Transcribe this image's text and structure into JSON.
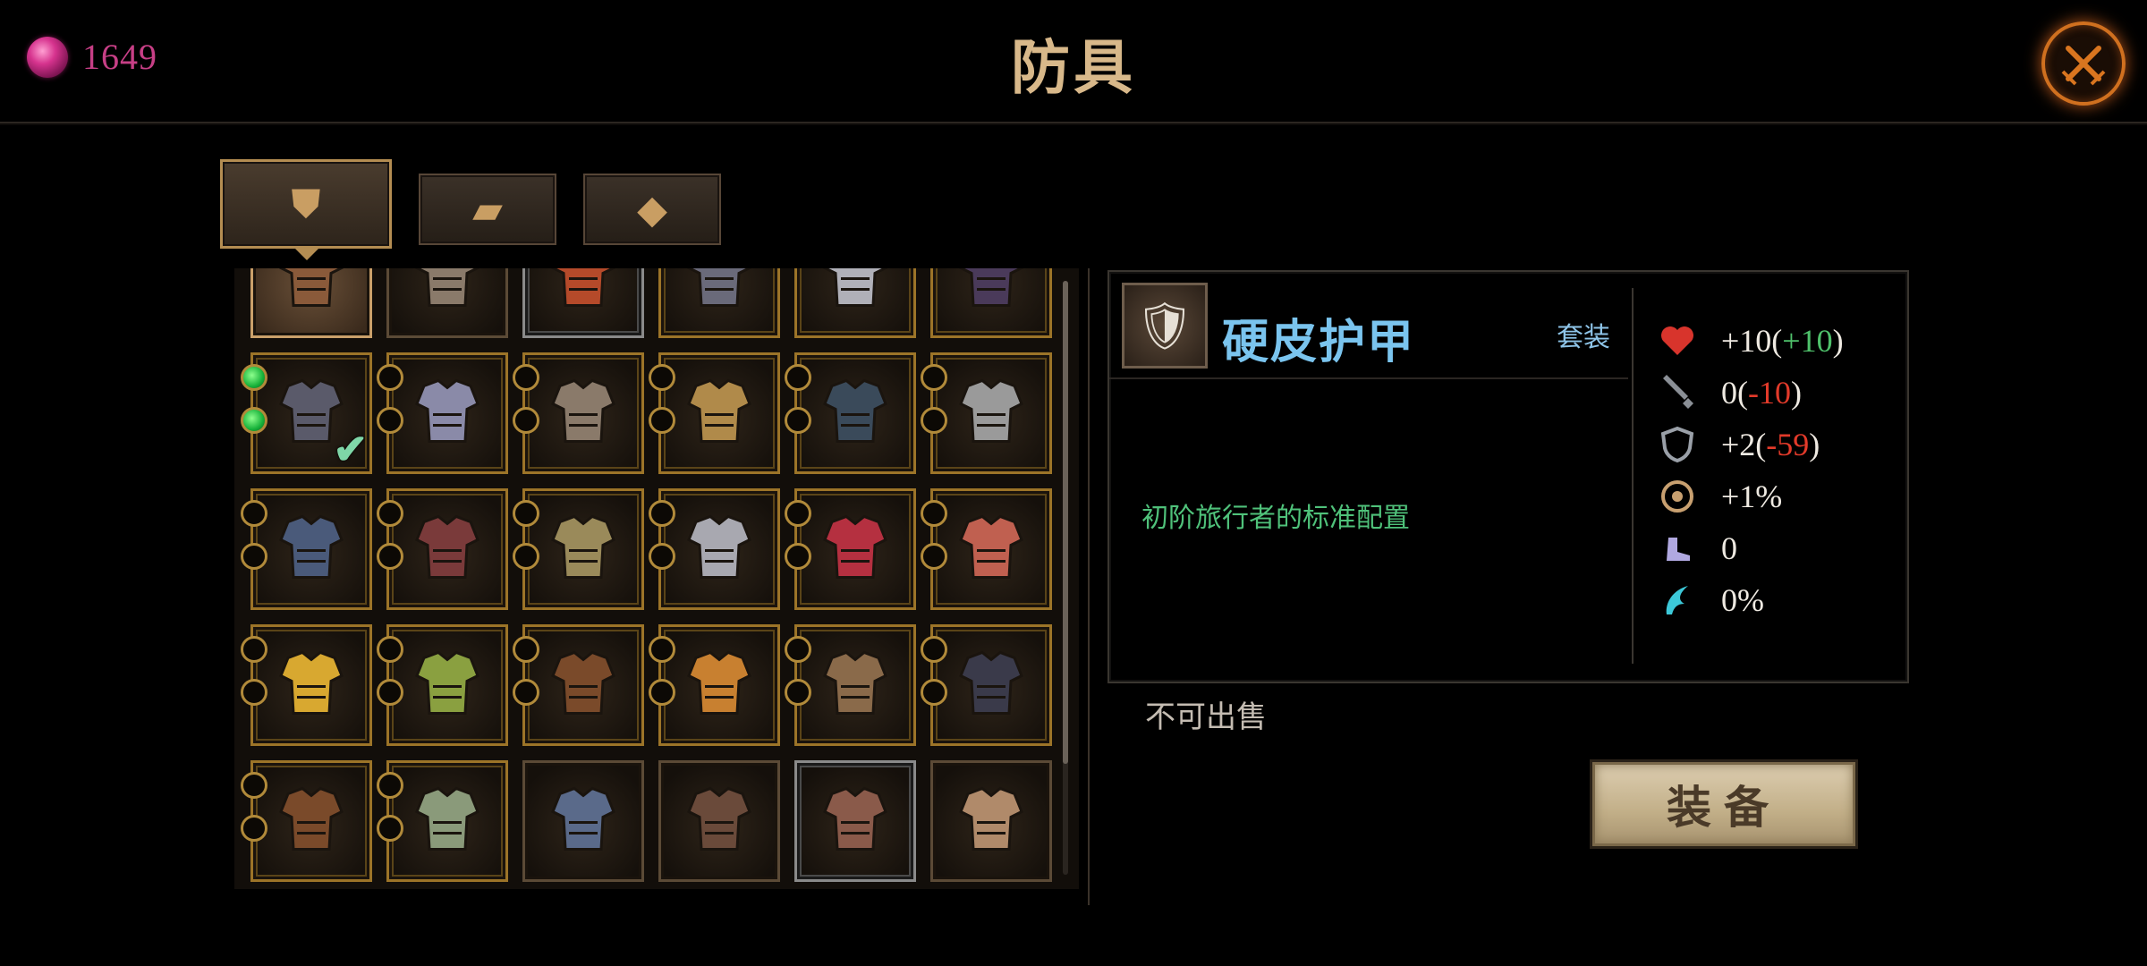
{
  "header": {
    "currency_value": "1649",
    "title": "防具",
    "close_icon": "close-crossed-swords-icon"
  },
  "tabs": [
    {
      "name": "armor",
      "icon": "chest-armor-icon",
      "active": true
    },
    {
      "name": "ingot",
      "icon": "ingot-icon",
      "active": false
    },
    {
      "name": "crystal",
      "icon": "crystal-icon",
      "active": false
    }
  ],
  "inventory": {
    "slots": [
      {
        "frame": "plain",
        "selected": true,
        "sockets": 0,
        "filled": 0,
        "color": "#8a5a3a",
        "equipped": false
      },
      {
        "frame": "plain",
        "selected": false,
        "sockets": 0,
        "filled": 0,
        "color": "#8a7a6a",
        "equipped": false
      },
      {
        "frame": "silver",
        "selected": false,
        "sockets": 0,
        "filled": 0,
        "color": "#b54a2a",
        "equipped": false
      },
      {
        "frame": "gold",
        "selected": false,
        "sockets": 1,
        "filled": 0,
        "color": "#6a6a7a",
        "equipped": false
      },
      {
        "frame": "gold",
        "selected": false,
        "sockets": 1,
        "filled": 0,
        "color": "#b0b0b8",
        "equipped": false
      },
      {
        "frame": "gold",
        "selected": false,
        "sockets": 1,
        "filled": 1,
        "color": "#4a3a5a",
        "equipped": false
      },
      {
        "frame": "gold",
        "selected": false,
        "sockets": 2,
        "filled": 2,
        "color": "#5a5a6a",
        "equipped": true
      },
      {
        "frame": "gold",
        "selected": false,
        "sockets": 2,
        "filled": 0,
        "color": "#8a8aa8",
        "equipped": false
      },
      {
        "frame": "gold",
        "selected": false,
        "sockets": 2,
        "filled": 0,
        "color": "#8a7a6a",
        "equipped": false
      },
      {
        "frame": "gold",
        "selected": false,
        "sockets": 2,
        "filled": 0,
        "color": "#b08a4a",
        "equipped": false
      },
      {
        "frame": "gold",
        "selected": false,
        "sockets": 2,
        "filled": 0,
        "color": "#3a4a5a",
        "equipped": false
      },
      {
        "frame": "gold",
        "selected": false,
        "sockets": 2,
        "filled": 0,
        "color": "#9a9a9a",
        "equipped": false
      },
      {
        "frame": "gold",
        "selected": false,
        "sockets": 2,
        "filled": 0,
        "color": "#4a5a7a",
        "equipped": false
      },
      {
        "frame": "gold",
        "selected": false,
        "sockets": 2,
        "filled": 0,
        "color": "#7a3a3a",
        "equipped": false
      },
      {
        "frame": "gold",
        "selected": false,
        "sockets": 2,
        "filled": 0,
        "color": "#9a8a5a",
        "equipped": false
      },
      {
        "frame": "gold",
        "selected": false,
        "sockets": 2,
        "filled": 0,
        "color": "#a8a8b0",
        "equipped": false
      },
      {
        "frame": "gold",
        "selected": false,
        "sockets": 2,
        "filled": 0,
        "color": "#b53040",
        "equipped": false
      },
      {
        "frame": "gold",
        "selected": false,
        "sockets": 2,
        "filled": 0,
        "color": "#c06050",
        "equipped": false
      },
      {
        "frame": "gold",
        "selected": false,
        "sockets": 2,
        "filled": 0,
        "color": "#d8a830",
        "equipped": false
      },
      {
        "frame": "gold",
        "selected": false,
        "sockets": 2,
        "filled": 0,
        "color": "#8aa040",
        "equipped": false
      },
      {
        "frame": "gold",
        "selected": false,
        "sockets": 2,
        "filled": 0,
        "color": "#7a4a2a",
        "equipped": false
      },
      {
        "frame": "gold",
        "selected": false,
        "sockets": 2,
        "filled": 0,
        "color": "#c88030",
        "equipped": false
      },
      {
        "frame": "gold",
        "selected": false,
        "sockets": 2,
        "filled": 0,
        "color": "#8a6a4a",
        "equipped": false
      },
      {
        "frame": "gold",
        "selected": false,
        "sockets": 2,
        "filled": 0,
        "color": "#3a3a4a",
        "equipped": false
      },
      {
        "frame": "gold",
        "selected": false,
        "sockets": 2,
        "filled": 0,
        "color": "#7a4a2a",
        "equipped": false
      },
      {
        "frame": "gold",
        "selected": false,
        "sockets": 2,
        "filled": 0,
        "color": "#8a9a7a",
        "equipped": false
      },
      {
        "frame": "plain",
        "selected": false,
        "sockets": 0,
        "filled": 0,
        "color": "#5a6a8a",
        "equipped": false
      },
      {
        "frame": "plain",
        "selected": false,
        "sockets": 0,
        "filled": 0,
        "color": "#6a4a3a",
        "equipped": false
      },
      {
        "frame": "silver",
        "selected": false,
        "sockets": 0,
        "filled": 0,
        "color": "#8a5a4a",
        "equipped": false
      },
      {
        "frame": "plain",
        "selected": false,
        "sockets": 0,
        "filled": 0,
        "color": "#b08a6a",
        "equipped": false
      }
    ]
  },
  "detail": {
    "item_name": "硬皮护甲",
    "set_label": "套装",
    "description": "初阶旅行者的标准配置",
    "stats": [
      {
        "icon": "heart-icon",
        "icon_color": "#d8342c",
        "base": "+10(",
        "delta": "+10",
        "delta_class": "pos",
        "tail": ")"
      },
      {
        "icon": "sword-icon",
        "icon_color": "#8a8f96",
        "base": "0(",
        "delta": "-10",
        "delta_class": "neg",
        "tail": ")"
      },
      {
        "icon": "shield-icon",
        "icon_color": "#9aa0a8",
        "base": "+2(",
        "delta": "-59",
        "delta_class": "neg",
        "tail": ")"
      },
      {
        "icon": "crit-target-icon",
        "icon_color": "#c8a070",
        "base": "+1%",
        "delta": "",
        "delta_class": "",
        "tail": ""
      },
      {
        "icon": "boot-icon",
        "icon_color": "#b0a8e0",
        "base": "0",
        "delta": "",
        "delta_class": "",
        "tail": ""
      },
      {
        "icon": "claw-icon",
        "icon_color": "#3cc8d8",
        "base": "0%",
        "delta": "",
        "delta_class": "",
        "tail": ""
      }
    ]
  },
  "sell_status": "不可出售",
  "equip_button_label": "装备",
  "colors": {
    "title": "#d8b88a",
    "currency": "#c73f86",
    "item_name": "#7ac4ee",
    "description": "#4fc17a",
    "positive": "#4fc16b",
    "negative": "#e23a2a"
  }
}
